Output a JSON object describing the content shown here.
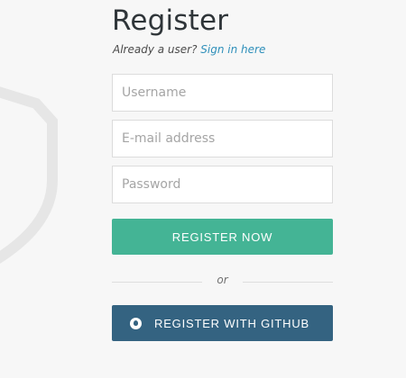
{
  "form": {
    "title": "Register",
    "subtitle_prefix": "Already a user?",
    "signin_link": "Sign in here",
    "username_placeholder": "Username",
    "email_placeholder": "E-mail address",
    "password_placeholder": "Password",
    "register_button": "REGISTER NOW",
    "divider_text": "or",
    "github_button": "REGISTER WITH GITHUB"
  },
  "icons": {
    "background_decoration": "shield-icon",
    "github": "github-icon"
  },
  "colors": {
    "background": "#f7f7f7",
    "primary_button": "#44b495",
    "github_button": "#346381",
    "link": "#2e8fba"
  }
}
